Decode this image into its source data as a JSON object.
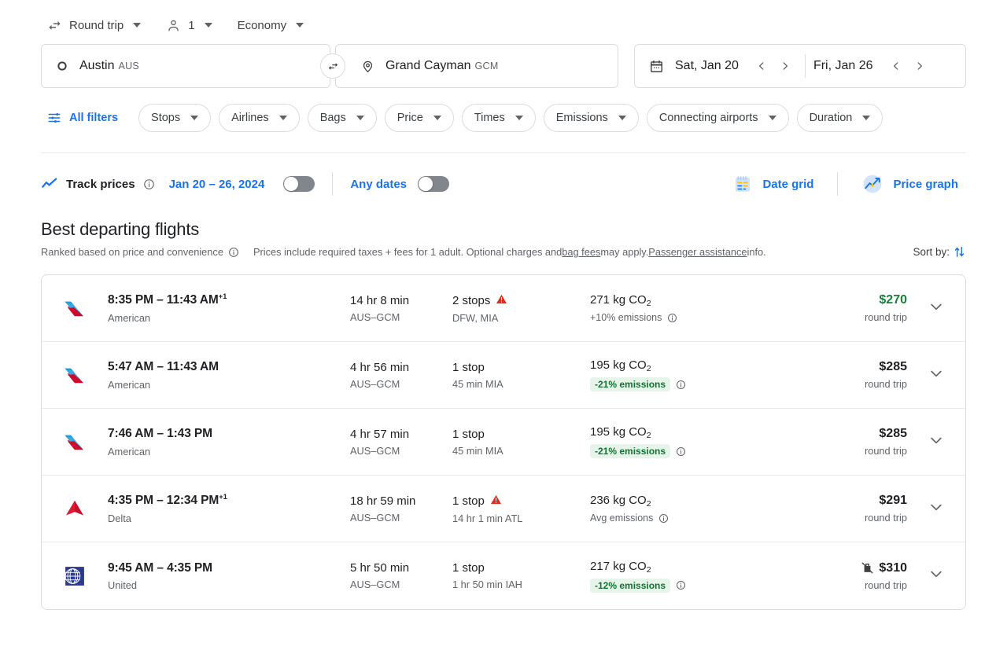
{
  "trip_options": [
    {
      "icon": "swap-horizontal-icon",
      "label": "Round trip"
    },
    {
      "icon": "person-icon",
      "label": "1"
    },
    {
      "icon": "",
      "label": "Economy"
    }
  ],
  "search": {
    "origin": {
      "city": "Austin",
      "code": "AUS",
      "icon": "circle-origin-icon"
    },
    "destination": {
      "city": "Grand Cayman",
      "code": "GCM",
      "icon": "map-pin-icon"
    },
    "swap_icon": "swap-arrows-icon",
    "depart_date": "Sat, Jan 20",
    "return_date": "Fri, Jan 26",
    "calendar_icon": "calendar-icon",
    "prev_icon": "chevron-left-icon",
    "next_icon": "chevron-right-icon"
  },
  "filters": {
    "all_filters_label": "All filters",
    "all_filters_icon": "tune-icon",
    "chips": [
      "Stops",
      "Airlines",
      "Bags",
      "Price",
      "Times",
      "Emissions",
      "Connecting airports",
      "Duration"
    ]
  },
  "track": {
    "icon": "trending-up-icon",
    "label": "Track prices",
    "info_icon": "info-icon",
    "date_range": "Jan 20 – 26, 2024",
    "toggle_on": false,
    "any_dates_label": "Any dates",
    "any_dates_toggle_on": false,
    "date_grid_label": "Date grid",
    "date_grid_icon": "date-grid-icon",
    "price_graph_label": "Price graph",
    "price_graph_icon": "price-graph-icon"
  },
  "best": {
    "title": "Best departing flights",
    "ranked_text": "Ranked based on price and convenience",
    "ranked_info_icon": "info-icon",
    "prices_text_1": "Prices include required taxes + fees for 1 adult. Optional charges and ",
    "bag_fees_link": "bag fees",
    "prices_text_2": " may apply. ",
    "passenger_assistance_link": "Passenger assistance",
    "prices_text_3": " info.",
    "sort_by_label": "Sort by:",
    "sort_icon": "sort-arrows-icon"
  },
  "flights": [
    {
      "airline_logo": "american-airlines-logo",
      "times": "8:35 PM – 11:43 AM",
      "day_offset": "+1",
      "airline": "American",
      "duration": "14 hr 8 min",
      "route": "AUS–GCM",
      "stops": "2 stops",
      "stops_warning": true,
      "stop_detail": "DFW, MIA",
      "emissions": "271 kg CO",
      "emissions_sub": "2",
      "emissions_note": "+10% emissions",
      "emissions_badge": false,
      "emissions_info_icon": "info-icon",
      "price": "$270",
      "price_green": true,
      "price_note": "round trip",
      "no_bag_icon": false,
      "expand_icon": "chevron-down-icon"
    },
    {
      "airline_logo": "american-airlines-logo",
      "times": "5:47 AM – 11:43 AM",
      "day_offset": "",
      "airline": "American",
      "duration": "4 hr 56 min",
      "route": "AUS–GCM",
      "stops": "1 stop",
      "stops_warning": false,
      "stop_detail": "45 min MIA",
      "emissions": "195 kg CO",
      "emissions_sub": "2",
      "emissions_note": "-21% emissions",
      "emissions_badge": true,
      "emissions_info_icon": "info-icon",
      "price": "$285",
      "price_green": false,
      "price_note": "round trip",
      "no_bag_icon": false,
      "expand_icon": "chevron-down-icon"
    },
    {
      "airline_logo": "american-airlines-logo",
      "times": "7:46 AM – 1:43 PM",
      "day_offset": "",
      "airline": "American",
      "duration": "4 hr 57 min",
      "route": "AUS–GCM",
      "stops": "1 stop",
      "stops_warning": false,
      "stop_detail": "45 min MIA",
      "emissions": "195 kg CO",
      "emissions_sub": "2",
      "emissions_note": "-21% emissions",
      "emissions_badge": true,
      "emissions_info_icon": "info-icon",
      "price": "$285",
      "price_green": false,
      "price_note": "round trip",
      "no_bag_icon": false,
      "expand_icon": "chevron-down-icon"
    },
    {
      "airline_logo": "delta-logo",
      "times": "4:35 PM – 12:34 PM",
      "day_offset": "+1",
      "airline": "Delta",
      "duration": "18 hr 59 min",
      "route": "AUS–GCM",
      "stops": "1 stop",
      "stops_warning": true,
      "stop_detail": "14 hr 1 min ATL",
      "emissions": "236 kg CO",
      "emissions_sub": "2",
      "emissions_note": "Avg emissions",
      "emissions_badge": false,
      "emissions_info_icon": "info-icon",
      "price": "$291",
      "price_green": false,
      "price_note": "round trip",
      "no_bag_icon": false,
      "expand_icon": "chevron-down-icon"
    },
    {
      "airline_logo": "united-logo",
      "times": "9:45 AM – 4:35 PM",
      "day_offset": "",
      "airline": "United",
      "duration": "5 hr 50 min",
      "route": "AUS–GCM",
      "stops": "1 stop",
      "stops_warning": false,
      "stop_detail": "1 hr 50 min IAH",
      "emissions": "217 kg CO",
      "emissions_sub": "2",
      "emissions_note": "-12% emissions",
      "emissions_badge": true,
      "emissions_info_icon": "info-icon",
      "price": "$310",
      "price_green": false,
      "price_note": "round trip",
      "no_bag_icon": true,
      "expand_icon": "chevron-down-icon"
    }
  ],
  "colors": {
    "accent_blue": "#1a73e8",
    "green_price": "#188038",
    "badge_green_bg": "#e6f4ea",
    "badge_green_text": "#137333",
    "warning_red": "#d93025"
  }
}
